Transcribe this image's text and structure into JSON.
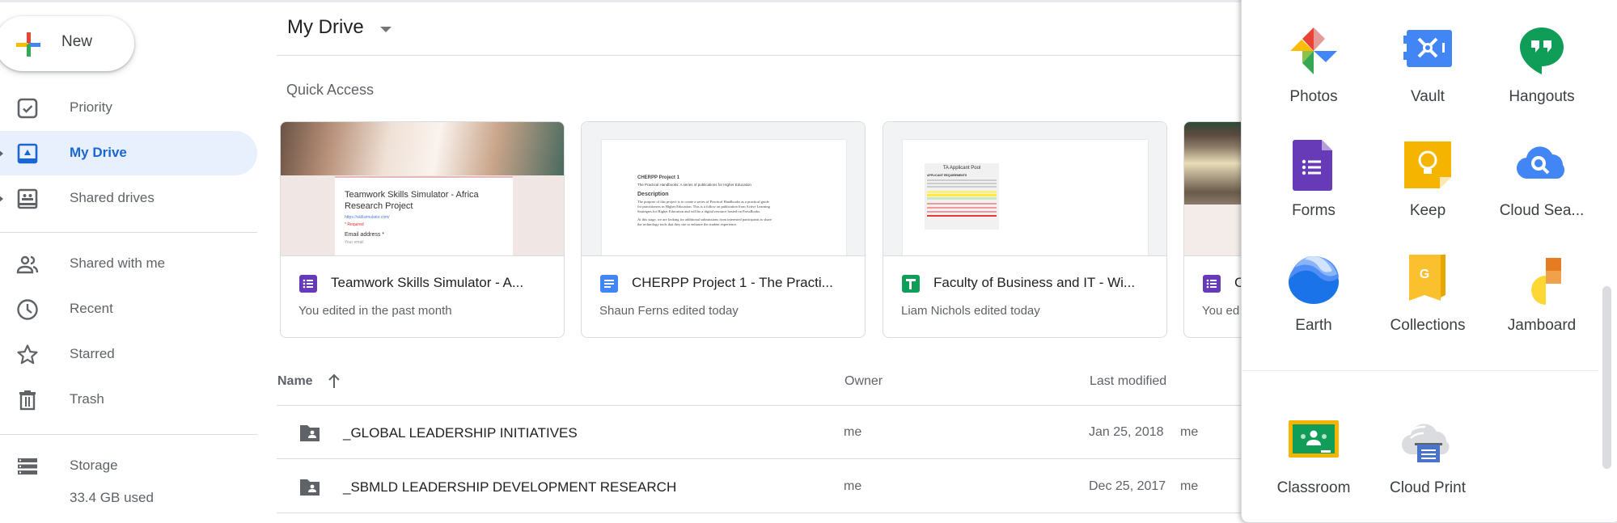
{
  "sidebar": {
    "new_label": "New",
    "items": [
      {
        "label": "Priority",
        "icon": "priority-checkbox-icon"
      },
      {
        "label": "My Drive",
        "icon": "my-drive-icon",
        "active": true
      },
      {
        "label": "Shared drives",
        "icon": "shared-drives-icon"
      },
      {
        "label": "Shared with me",
        "icon": "shared-with-me-icon"
      },
      {
        "label": "Recent",
        "icon": "clock-icon"
      },
      {
        "label": "Starred",
        "icon": "star-icon"
      },
      {
        "label": "Trash",
        "icon": "trash-icon"
      }
    ],
    "storage": {
      "label": "Storage",
      "used": "33.4 GB used"
    }
  },
  "header": {
    "title": "My Drive"
  },
  "quick_access": {
    "label": "Quick Access",
    "thumb_text": {
      "form_title": "Teamwork Skills Simulator - Africa Research Project",
      "form_link": "https://skillsimulator.com/",
      "form_required": "* Required",
      "form_field": "Email address *",
      "form_placeholder": "Your email",
      "doc_title": "CHERPP Project 1",
      "doc_subtitle": "The Practical Handbooks: A series of publications for Higher Education",
      "doc_heading": "Description",
      "doc_body1": "The purpose of this project is to create a series of Practical Handbooks as a practical guide",
      "doc_body2": "for practitioners in Higher Education. This is a follow on publication from Active Learning",
      "doc_body3": "Strategies for Higher Education and will be a digital resource hosted on PressBooks.",
      "doc_body4": "At this stage, we are looking for additional submissions from interested participants to share",
      "doc_body5": "the technology tools that they use to enhance the student experience.",
      "sheet_title": "TA Applicant Pool",
      "sheet_section": "APPLICANT REQUIREMENTS"
    },
    "cards": [
      {
        "name": "Teamwork Skills Simulator - A...",
        "subtitle": "You edited in the past month",
        "type": "form",
        "icon_color": "#673ab7"
      },
      {
        "name": "CHERPP Project 1 - The Practi...",
        "subtitle": "Shaun Ferns edited today",
        "type": "doc",
        "icon_color": "#4285f4"
      },
      {
        "name": "Faculty of Business and IT - Wi...",
        "subtitle": "Liam Nichols edited today",
        "type": "sheet",
        "icon_color": "#0f9d58"
      },
      {
        "name": "C",
        "subtitle": "You ed",
        "type": "form",
        "icon_color": "#673ab7"
      }
    ]
  },
  "file_list": {
    "columns": {
      "name": "Name",
      "sort_icon": "arrow-up-icon",
      "owner": "Owner",
      "last_modified": "Last modified"
    },
    "rows": [
      {
        "name": "_GLOBAL LEADERSHIP INITIATIVES",
        "owner": "me",
        "modified": "Jan 25, 2018",
        "modified_by": "me",
        "icon": "shared-folder-icon"
      },
      {
        "name": "_SBMLD LEADERSHIP DEVELOPMENT RESEARCH",
        "owner": "me",
        "modified": "Dec 25, 2017",
        "modified_by": "me",
        "icon": "shared-folder-icon"
      }
    ]
  },
  "apps_panel": {
    "apps": [
      {
        "label": "Photos",
        "icon": "photos-icon"
      },
      {
        "label": "Vault",
        "icon": "vault-icon"
      },
      {
        "label": "Hangouts",
        "icon": "hangouts-icon"
      },
      {
        "label": "Forms",
        "icon": "forms-icon"
      },
      {
        "label": "Keep",
        "icon": "keep-icon"
      },
      {
        "label": "Cloud Sea...",
        "icon": "cloud-search-icon"
      },
      {
        "label": "Earth",
        "icon": "earth-icon"
      },
      {
        "label": "Collections",
        "icon": "collections-icon"
      },
      {
        "label": "Jamboard",
        "icon": "jamboard-icon"
      },
      {
        "label": "Classroom",
        "icon": "classroom-icon"
      },
      {
        "label": "Cloud Print",
        "icon": "cloud-print-icon"
      }
    ]
  },
  "colors": {
    "accent_blue": "#1967d2",
    "active_bg": "#e8f0fe",
    "text_secondary": "#5f6368"
  }
}
